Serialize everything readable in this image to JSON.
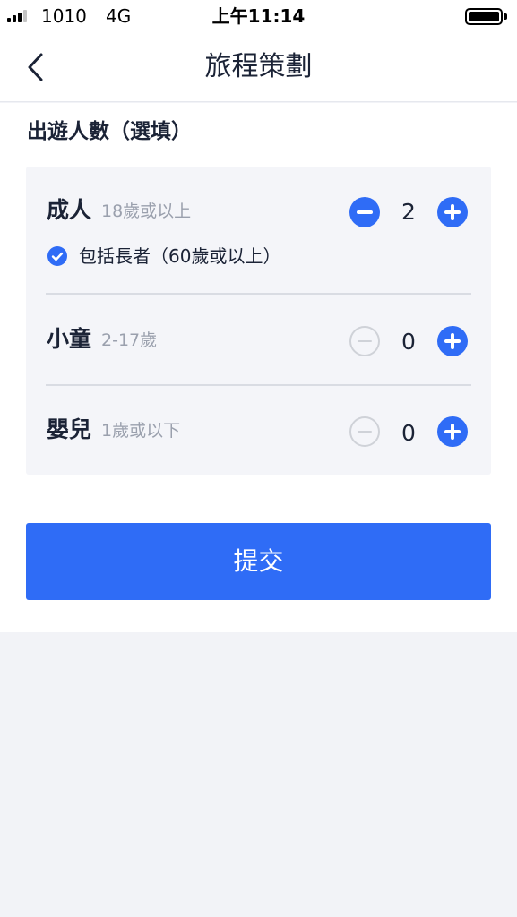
{
  "status_bar": {
    "carrier": "1010",
    "network": "4G",
    "time": "上午11:14"
  },
  "nav": {
    "title": "旅程策劃",
    "back_icon": "chevron-left-icon"
  },
  "section": {
    "title": "出遊人數（選填）"
  },
  "travellers": [
    {
      "label": "成人",
      "sub": "18歲或以上",
      "count": "2",
      "minus_enabled": true
    },
    {
      "label": "小童",
      "sub": "2-17歲",
      "count": "0",
      "minus_enabled": false
    },
    {
      "label": "嬰兒",
      "sub": "1歲或以下",
      "count": "0",
      "minus_enabled": false
    }
  ],
  "senior_option": {
    "label": "包括長者（60歲或以上）",
    "checked": true
  },
  "submit": {
    "label": "提交"
  },
  "colors": {
    "accent": "#2f6cf6",
    "text": "#1b2336",
    "muted": "#9aa0ad",
    "disabled": "#cfd2d8"
  }
}
